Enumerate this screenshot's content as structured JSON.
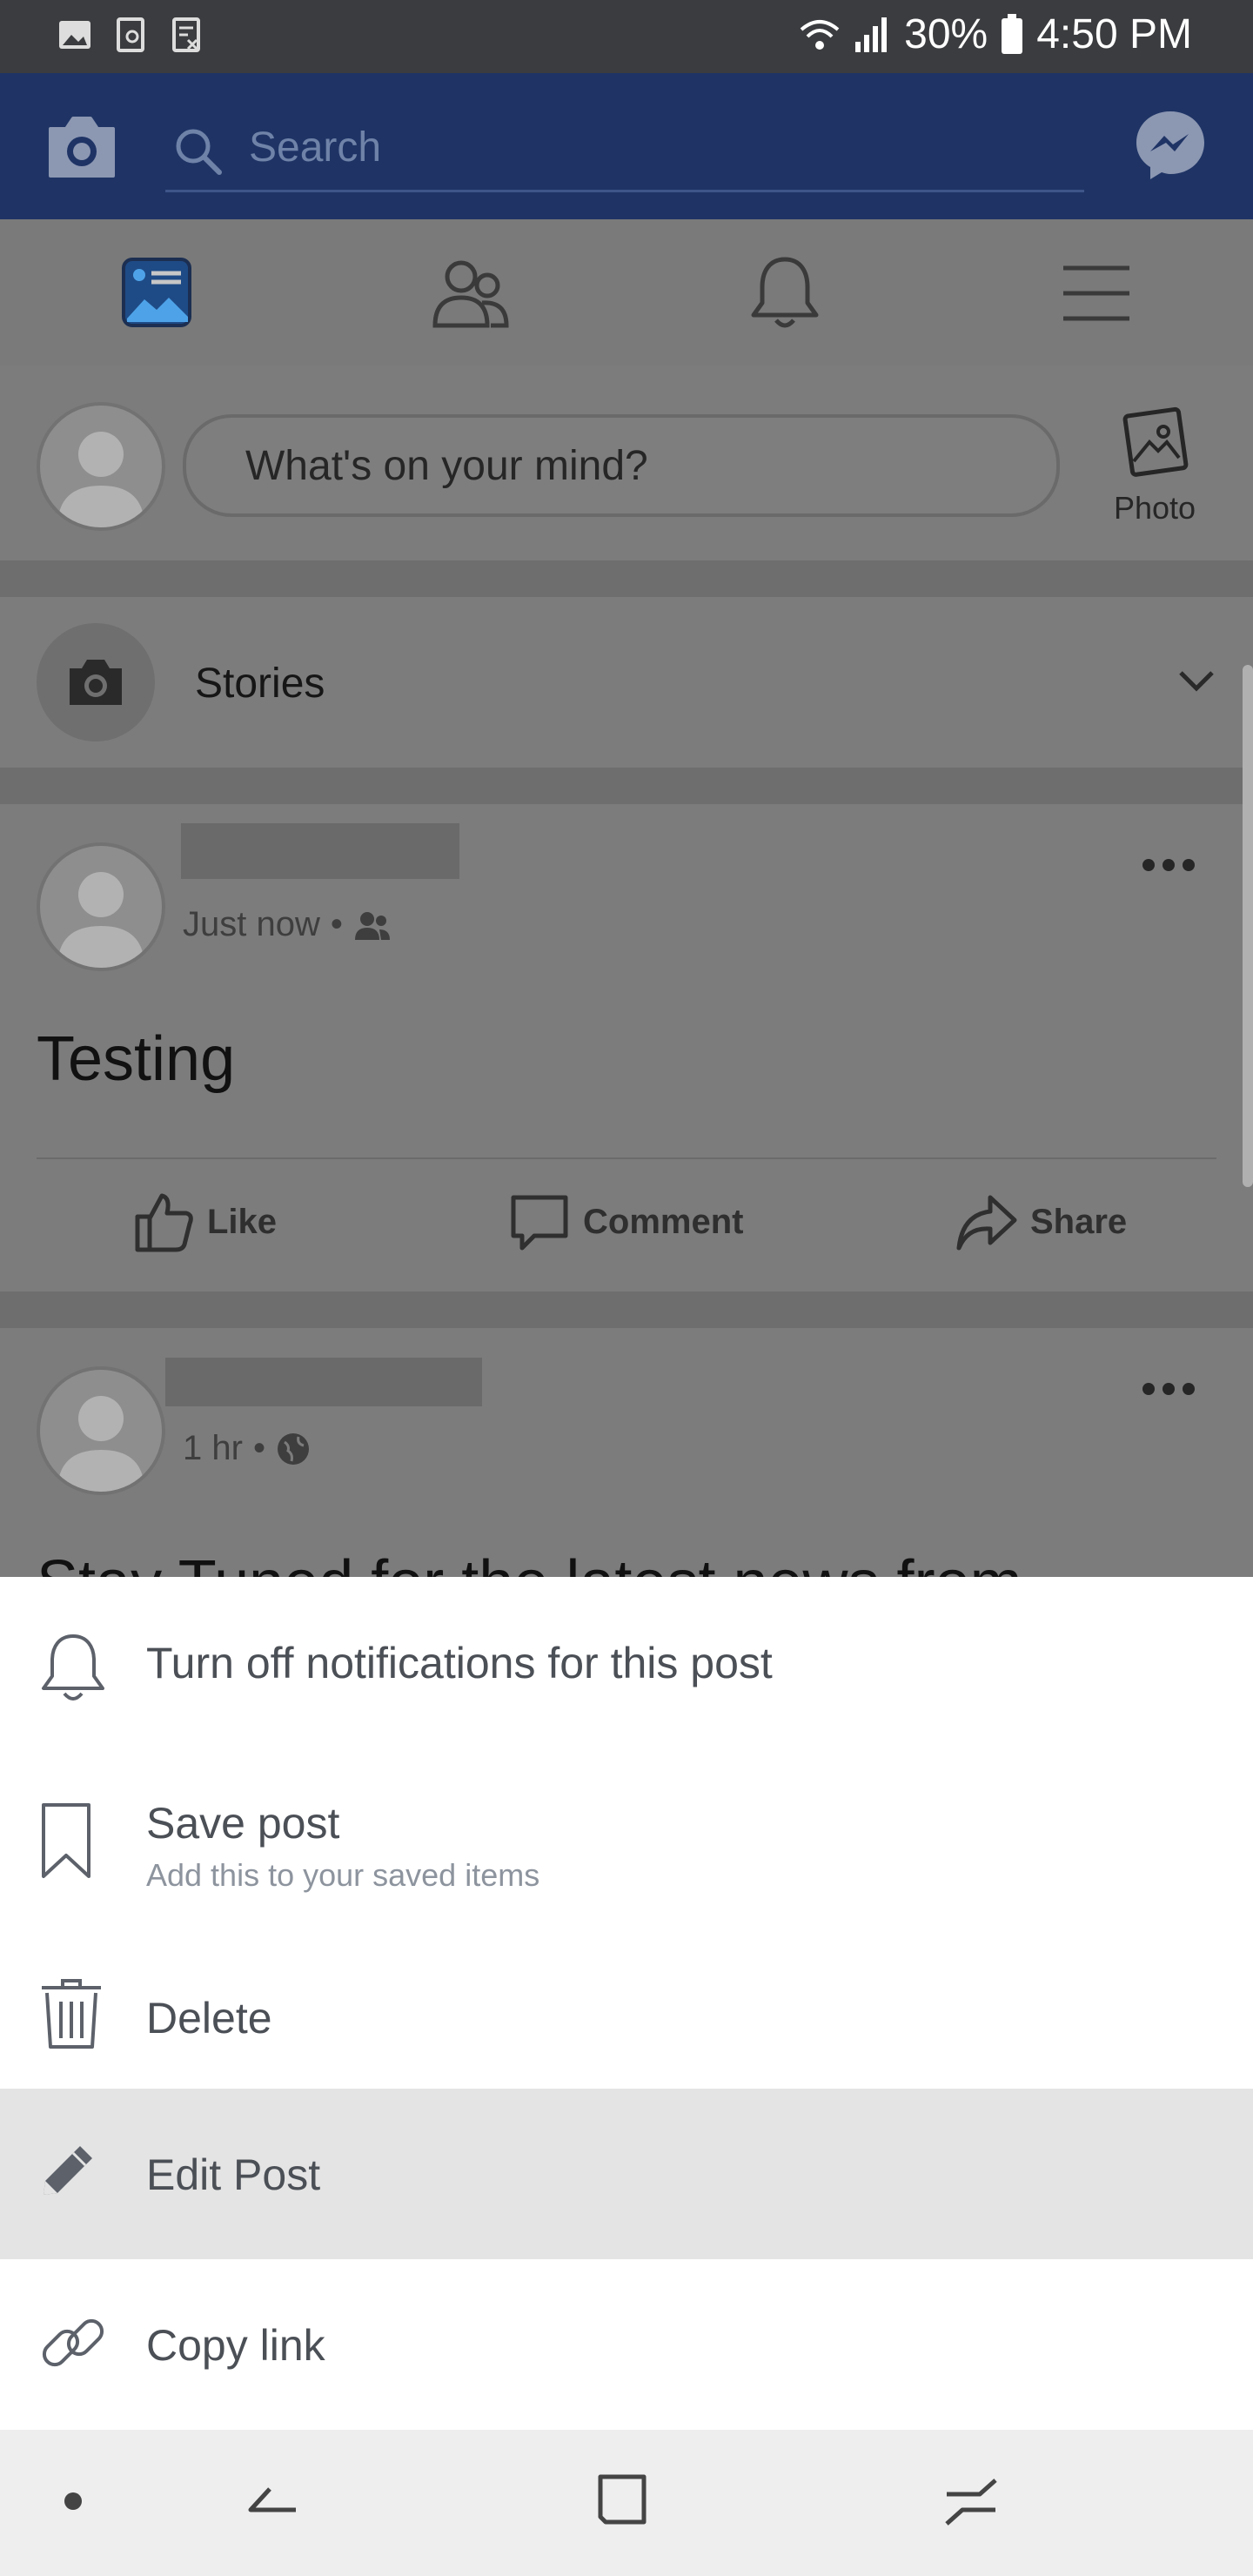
{
  "status": {
    "battery": "30%",
    "time": "4:50 PM"
  },
  "header": {
    "search_placeholder": "Search"
  },
  "nav": {
    "tabs": [
      {
        "name": "news-feed-icon"
      },
      {
        "name": "friends-icon"
      },
      {
        "name": "notifications-icon"
      },
      {
        "name": "menu-icon"
      }
    ]
  },
  "composer": {
    "prompt": "What's on your mind?",
    "photo_label": "Photo"
  },
  "stories": {
    "label": "Stories"
  },
  "post1": {
    "time": "Just now",
    "text": "Testing",
    "actions": {
      "like": "Like",
      "comment": "Comment",
      "share": "Share"
    }
  },
  "post2": {
    "time": "1 hr",
    "text_preview": "Stay Tuned for the latest news from"
  },
  "sheet": {
    "items": [
      {
        "label": "Turn off notifications for this post",
        "icon": "bell-icon"
      },
      {
        "label": "Save post",
        "sublabel": "Add this to your saved items",
        "icon": "bookmark-icon"
      },
      {
        "label": "Delete",
        "icon": "trash-icon"
      },
      {
        "label": "Edit Post",
        "icon": "pencil-icon",
        "highlighted": true
      },
      {
        "label": "Copy link",
        "icon": "link-icon"
      }
    ]
  },
  "colors": {
    "brand_blue": "#3b5998",
    "highlight": "#e4e4e4"
  }
}
